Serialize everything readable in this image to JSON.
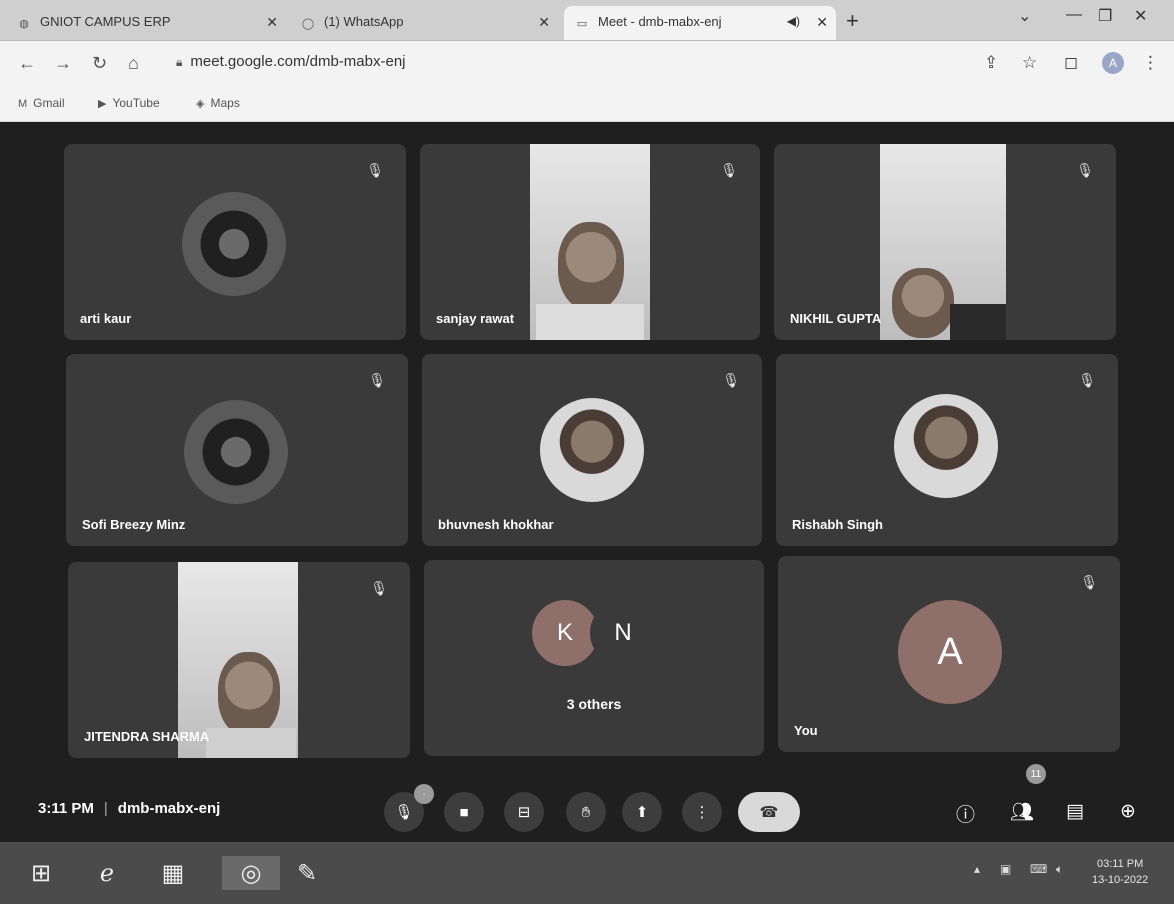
{
  "browser": {
    "tabs": [
      {
        "title": "GNIOT CAMPUS ERP",
        "icon": "globe-icon"
      },
      {
        "title": "(1) WhatsApp",
        "icon": "whatsapp-icon"
      },
      {
        "title": "Meet - dmb-mabx-enj",
        "icon": "meet-icon",
        "active": true
      }
    ],
    "url": "meet.google.com/dmb-mabx-enj",
    "bookmarks": [
      "Gmail",
      "YouTube",
      "Maps"
    ],
    "profile_initial": "A"
  },
  "meet": {
    "participants": [
      {
        "name": "arti kaur"
      },
      {
        "name": "sanjay rawat"
      },
      {
        "name": "NIKHIL GUPTA"
      },
      {
        "name": "Sofi Breezy Minz"
      },
      {
        "name": "bhuvnesh khokhar"
      },
      {
        "name": "Rishabh Singh"
      },
      {
        "name": "JITENDRA SHARMA"
      },
      {
        "name": "3 others",
        "initials": [
          "K",
          "N"
        ]
      },
      {
        "name": "You",
        "initial": "A"
      }
    ],
    "time": "3:11 PM",
    "meeting_code": "dmb-mabx-enj",
    "participant_count": "11"
  },
  "taskbar": {
    "time": "03:11 PM",
    "date": "13-10-2022"
  }
}
